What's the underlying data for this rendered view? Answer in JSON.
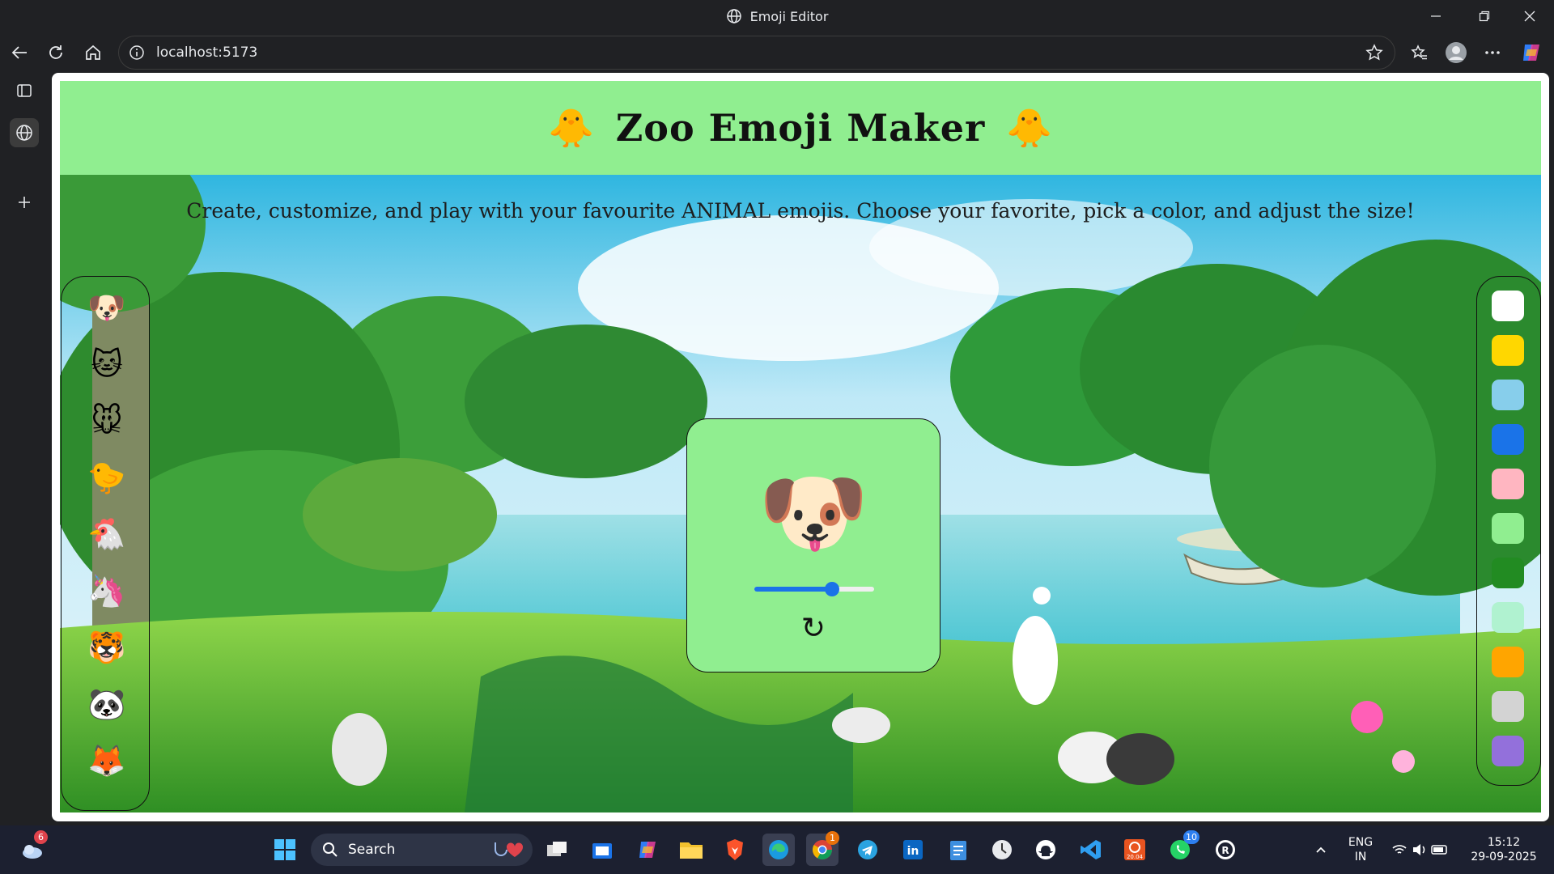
{
  "window": {
    "title": "Emoji Editor",
    "minimize_icon": "minimize-icon",
    "maximize_icon": "restore-icon",
    "close_icon": "close-icon"
  },
  "toolbar": {
    "url": "localhost:5173",
    "icons": [
      "back-icon",
      "refresh-icon",
      "home-icon",
      "site-info-icon",
      "favorite-star-icon",
      "favorites-icon",
      "profile-icon",
      "more-icon",
      "copilot-icon"
    ]
  },
  "sidebar": {
    "icons": [
      "tab-actions-icon",
      "pdf-icon",
      "browser-tab-icon",
      "add-icon"
    ]
  },
  "page": {
    "header": {
      "title": "Zoo Emoji Maker",
      "left_emoji": "🐥",
      "right_emoji": "🐥"
    },
    "subtitle": "Create, customize, and play with your favourite ANIMAL emojis. Choose your favorite, pick a color, and adjust the size!",
    "animals": [
      {
        "emoji": "🐶",
        "name": "dog"
      },
      {
        "emoji": "🐱",
        "name": "cat"
      },
      {
        "emoji": "🐭",
        "name": "mouse"
      },
      {
        "emoji": "🐤",
        "name": "chick"
      },
      {
        "emoji": "🐔",
        "name": "chicken"
      },
      {
        "emoji": "🦄",
        "name": "unicorn"
      },
      {
        "emoji": "🐯",
        "name": "tiger"
      },
      {
        "emoji": "🐼",
        "name": "panda"
      },
      {
        "emoji": "🦊",
        "name": "fox"
      }
    ],
    "colors": [
      "#FFFFFF",
      "#FFD700",
      "#87CEEB",
      "#1A73E8",
      "#FFB6C1",
      "#90EE90",
      "#228B22",
      "#B0F2D0",
      "#FFA500",
      "#D3D3D3",
      "#9370DB"
    ],
    "preview": {
      "emoji": "🐶",
      "size_fraction": 0.65,
      "reset_symbol": "↻"
    }
  },
  "taskbar": {
    "weather_badge": "6",
    "search_label": "Search",
    "chrome_badge": "1",
    "ubuntu_label": "20.04",
    "whatsapp_badge": "10",
    "language": "ENG",
    "region": "IN",
    "time": "15:12",
    "date": "29-09-2025"
  }
}
